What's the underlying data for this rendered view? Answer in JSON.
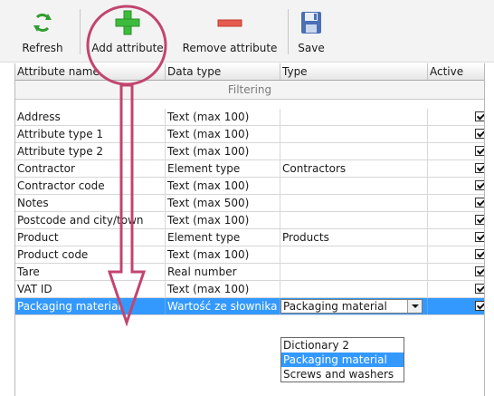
{
  "toolbar": {
    "refresh_label": "Refresh",
    "add_label": "Add attribute",
    "remove_label": "Remove attribute",
    "save_label": "Save"
  },
  "grid": {
    "headers": [
      "Attribute name",
      "Data type",
      "Type",
      "Active"
    ],
    "filter_label": "Filtering",
    "rows": [
      {
        "name": "Address",
        "data_type": "Text (max 100)",
        "type": "",
        "active": true
      },
      {
        "name": "Attribute type 1",
        "data_type": "Text (max 100)",
        "type": "",
        "active": true
      },
      {
        "name": "Attribute type 2",
        "data_type": "Text (max 100)",
        "type": "",
        "active": true
      },
      {
        "name": "Contractor",
        "data_type": "Element type",
        "type": "Contractors",
        "active": true
      },
      {
        "name": "Contractor code",
        "data_type": "Text (max 100)",
        "type": "",
        "active": true
      },
      {
        "name": "Notes",
        "data_type": "Text (max 500)",
        "type": "",
        "active": true
      },
      {
        "name": "Postcode and city/town",
        "data_type": "Text (max 100)",
        "type": "",
        "active": true
      },
      {
        "name": "Product",
        "data_type": "Element type",
        "type": "Products",
        "active": true
      },
      {
        "name": "Product code",
        "data_type": "Text (max 100)",
        "type": "",
        "active": true
      },
      {
        "name": "Tare",
        "data_type": "Real number",
        "type": "",
        "active": true
      },
      {
        "name": "VAT ID",
        "data_type": "Text (max 100)",
        "type": "",
        "active": true
      },
      {
        "name": "Packaging material",
        "data_type": "Wartość ze słownika",
        "type": "Packaging material",
        "active": true
      }
    ]
  },
  "dropdown": {
    "options": [
      "Dictionary 2",
      "Packaging material",
      "Screws and washers"
    ],
    "highlighted": "Packaging material"
  },
  "colors": {
    "selection": "#3399ff",
    "annotation": "#c2456f"
  },
  "icons": {
    "refresh": "refresh-icon",
    "add": "plus-icon",
    "remove": "minus-icon",
    "save": "floppy-disk-icon"
  }
}
